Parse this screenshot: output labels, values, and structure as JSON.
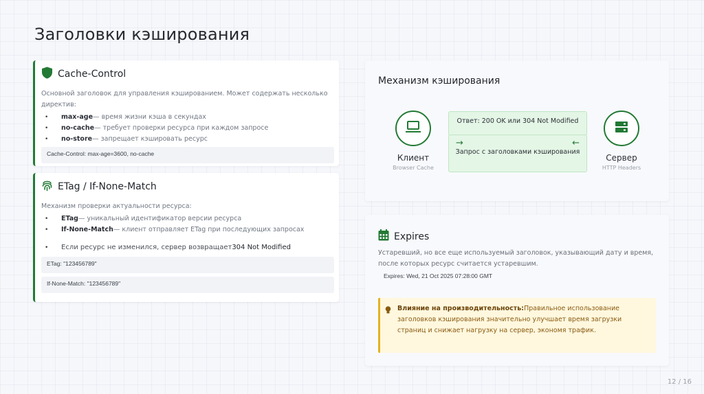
{
  "page": {
    "title": "Заголовки кэширования",
    "page_number": "12 / 16"
  },
  "cache_control": {
    "title": "Cache-Control",
    "icon": "shield-icon",
    "description": "Основной заголовок для управления кэшированием. Может содержать несколько директив:",
    "items": [
      {
        "key": "max-age",
        "text": "— время жизни кэша в секундах"
      },
      {
        "key": "no-cache",
        "text": "— требует проверки ресурса при каждом запросе"
      },
      {
        "key": "no-store",
        "text": "— запрещает кэшировать ресурс"
      }
    ],
    "code": "Cache-Control: max-age=3600, no-cache"
  },
  "etag": {
    "title": "ETag / If-None-Match",
    "icon": "fingerprint-icon",
    "description": "Механизм проверки актуальности ресурса:",
    "items": [
      {
        "key": "ETag",
        "text": "— уникальный идентификатор версии ресурса"
      },
      {
        "key": "If-None-Match",
        "text": "— клиент отправляет ETag при последующих запросах"
      }
    ],
    "note_prefix": "Если ресурс не изменился, сервер возвращает",
    "note_value": "304 Not Modified",
    "code1": "ETag: \"123456789\"",
    "code2": "If-None-Match: \"123456789\""
  },
  "mechanism": {
    "title": "Механизм кэширования",
    "client": {
      "label": "Клиент",
      "sub": "Browser Cache",
      "icon": "laptop-icon"
    },
    "server": {
      "label": "Сервер",
      "sub": "HTTP Headers",
      "icon": "server-icon"
    },
    "response": "Ответ: 200 OK или 304 Not Modified",
    "request": "Запрос с заголовками кэширования"
  },
  "expires": {
    "title": "Expires",
    "icon": "calendar-icon",
    "description": "Устаревший, но все еще используемый заголовок, указывающий дату и время, после которых ресурс считается устаревшим.",
    "code": "Expires: Wed, 21 Oct 2025 07:28:00 GMT",
    "tip_bold": "Влияние на производительность:",
    "tip_text": "Правильное использование заголовков кэширования значительно улучшает время загрузки страниц и снижает нагрузку на сервер, экономя трафик.",
    "tip_icon": "lightbulb-icon"
  },
  "colors": {
    "accent": "#237a35",
    "warning": "#e3b223",
    "warning_text": "#8a5a12"
  }
}
